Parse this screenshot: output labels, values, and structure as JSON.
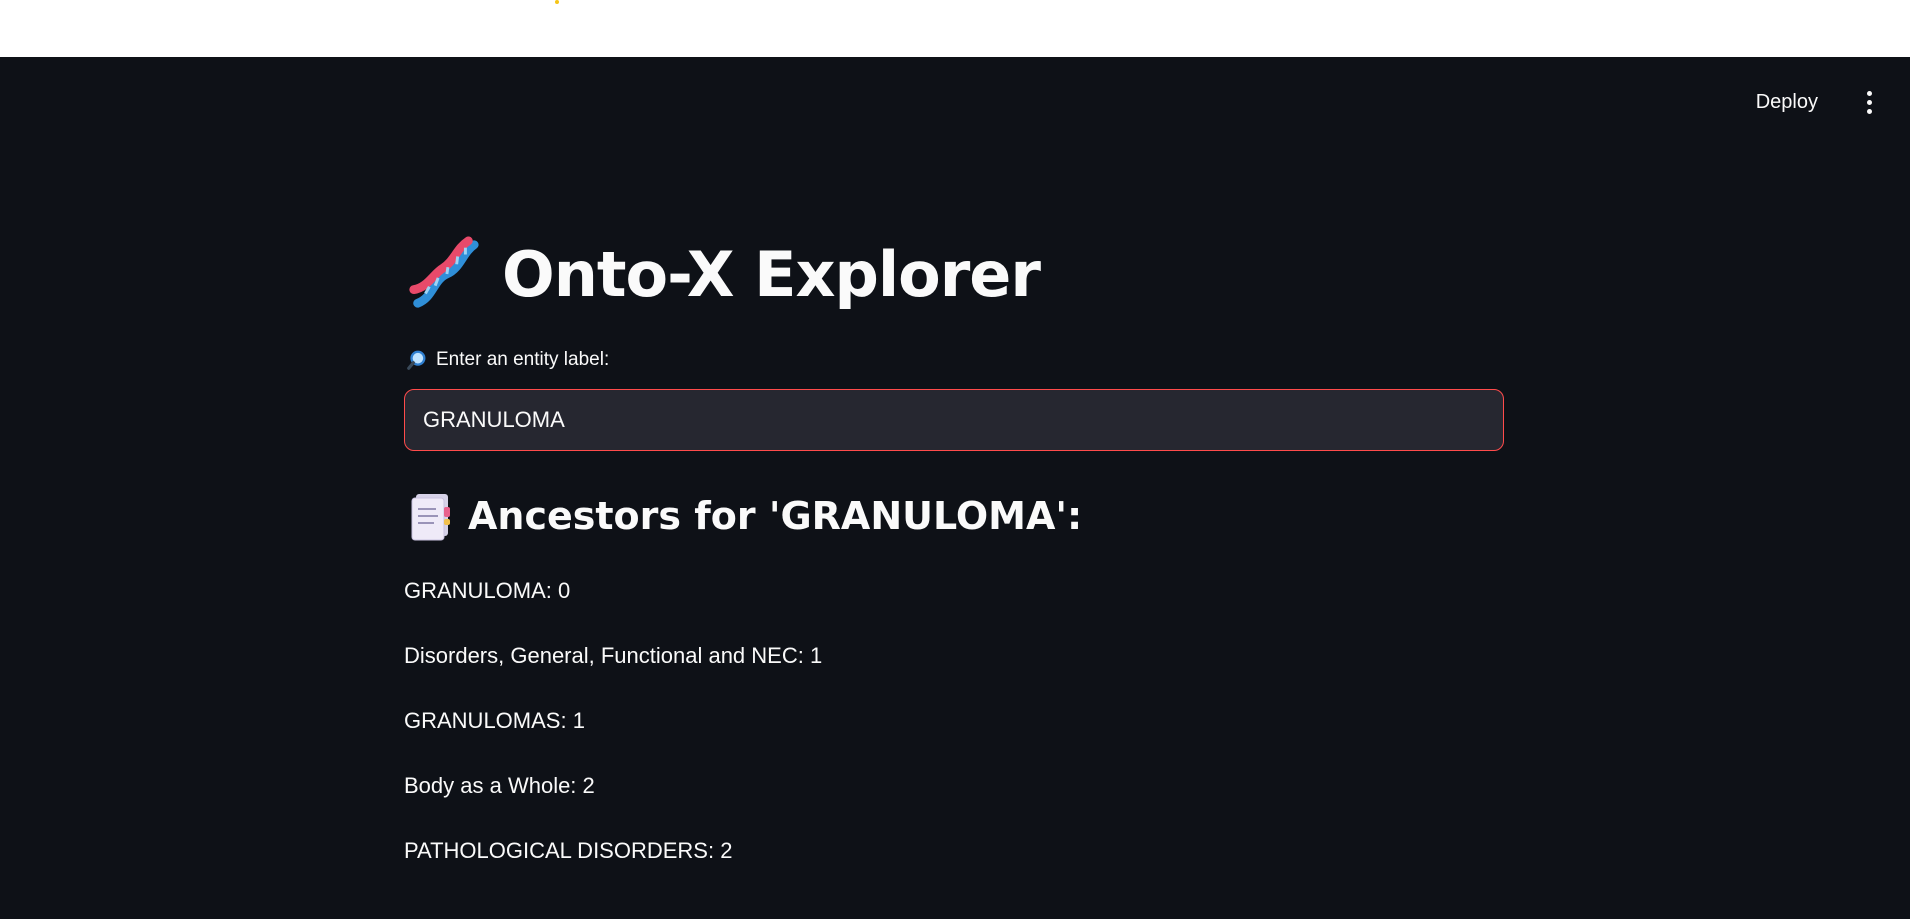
{
  "header": {
    "deploy_label": "Deploy",
    "menu_icon": "kebab-menu-icon"
  },
  "main": {
    "title": "Onto-X Explorer",
    "title_icon": "dna-icon",
    "search": {
      "label": "Enter an entity label:",
      "label_icon": "magnifier-icon",
      "value": "GRANULOMA"
    },
    "ancestors": {
      "heading": "Ancestors for 'GRANULOMA':",
      "heading_icon": "document-icon",
      "items": [
        "GRANULOMA: 0",
        "Disorders, General, Functional and NEC: 1",
        "GRANULOMAS: 1",
        "Body as a Whole: 2",
        "PATHOLOGICAL DISORDERS: 2"
      ]
    }
  },
  "colors": {
    "background": "#0e1117",
    "text": "#fafafa",
    "input_background": "#262730",
    "input_border": "#ff4b4b"
  }
}
